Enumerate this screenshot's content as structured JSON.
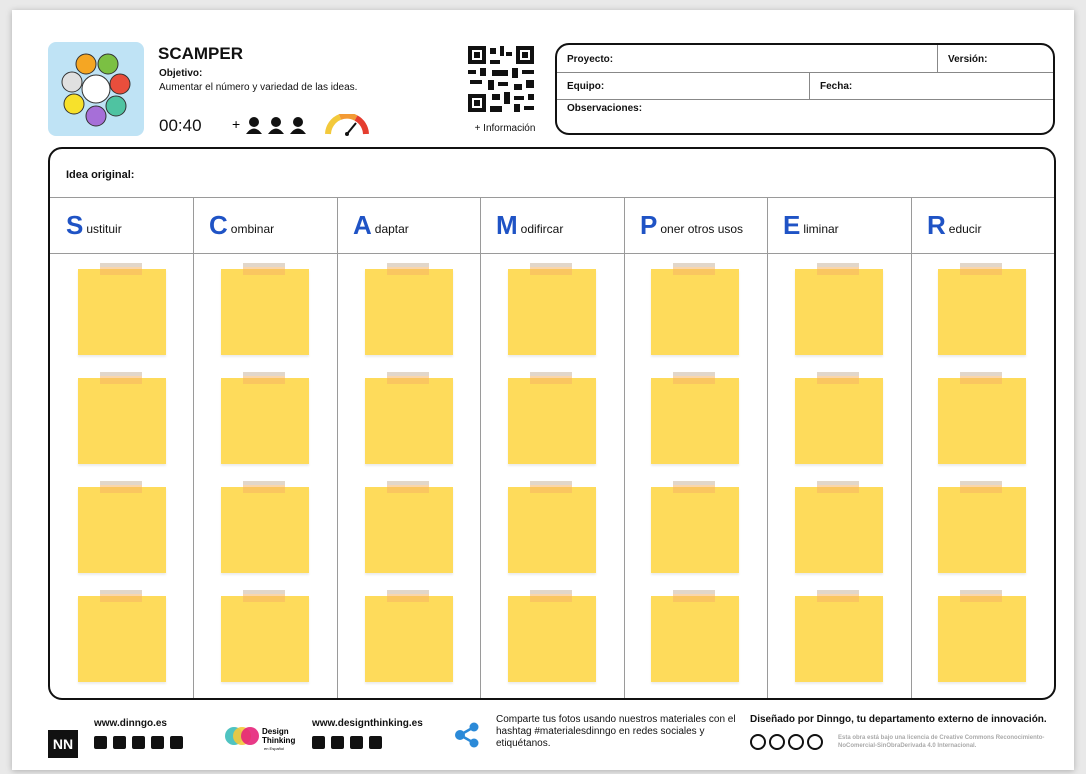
{
  "header": {
    "title": "SCAMPER",
    "objective_label": "Objetivo:",
    "objective_text": "Aumentar el número y variedad de las ideas.",
    "time": "00:40",
    "people_plus": "+",
    "qr_label": "+ Información"
  },
  "info": {
    "project_label": "Proyecto:",
    "version_label": "Versión:",
    "team_label": "Equipo:",
    "date_label": "Fecha:",
    "notes_label": "Observaciones:"
  },
  "board": {
    "idea_label": "Idea original:",
    "columns": [
      {
        "letter": "S",
        "rest": "ustituir"
      },
      {
        "letter": "C",
        "rest": "ombinar"
      },
      {
        "letter": "A",
        "rest": "daptar"
      },
      {
        "letter": "M",
        "rest": "odifircar"
      },
      {
        "letter": "P",
        "rest": "oner otros usos"
      },
      {
        "letter": "E",
        "rest": "liminar"
      },
      {
        "letter": "R",
        "rest": "educir"
      }
    ],
    "notes_per_column": 4,
    "note_color": "#fedb5b",
    "accent_color": "#1f53c5"
  },
  "footer": {
    "nn_logo": "NN",
    "dinngo_url": "www.dinngo.es",
    "dt_logo_line1": "Design",
    "dt_logo_line2": "Thinking",
    "dt_logo_line3": "en Español",
    "dt_url": "www.designthinking.es",
    "share_text": "Comparte tus fotos usando nuestros materiales con el hashtag #materialesdinngo en redes sociales y etiquétanos.",
    "designed_by": "Diseñado por Dinngo, tu departamento externo de innovación.",
    "license_text": "Esta obra está bajo una licencia de Creative Commons Reconocimiento-NoComercial-SinObraDerivada 4.0 Internacional."
  }
}
